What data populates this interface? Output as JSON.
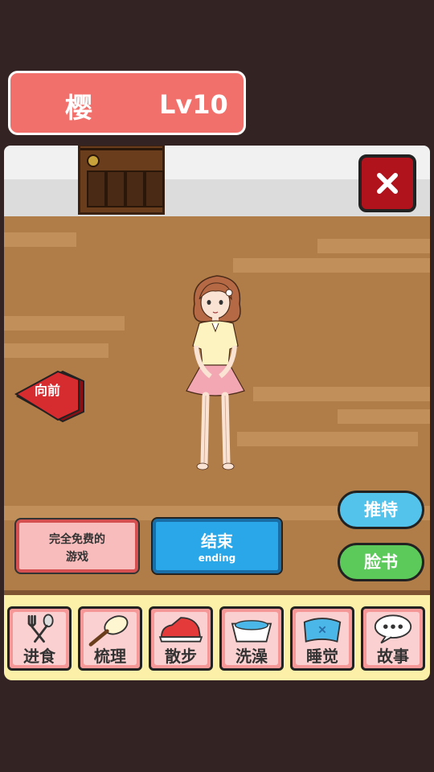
{
  "header": {
    "name": "樱",
    "level": "Lv10"
  },
  "navigation": {
    "forward_label": "向前"
  },
  "buttons": {
    "free_games_line1": "完全免费的",
    "free_games_line2": "游戏",
    "ending_label": "结束",
    "ending_sub": "ending",
    "twitter_label": "推特",
    "facebook_label": "脸书"
  },
  "actions": [
    {
      "label": "进食",
      "icon": "fork-spoon-icon"
    },
    {
      "label": "梳理",
      "icon": "brush-icon"
    },
    {
      "label": "散步",
      "icon": "sneaker-icon"
    },
    {
      "label": "洗澡",
      "icon": "bathtub-icon"
    },
    {
      "label": "睡觉",
      "icon": "pillow-icon"
    },
    {
      "label": "故事",
      "icon": "speech-bubble-icon"
    }
  ],
  "colors": {
    "title_bg": "#f2706c",
    "close_bg": "#b1131c",
    "ending_bg": "#29a7e8",
    "twitter_bg": "#54c3ec",
    "facebook_bg": "#5cc95b",
    "action_bg": "#f69898",
    "floor": "#b07d48"
  }
}
